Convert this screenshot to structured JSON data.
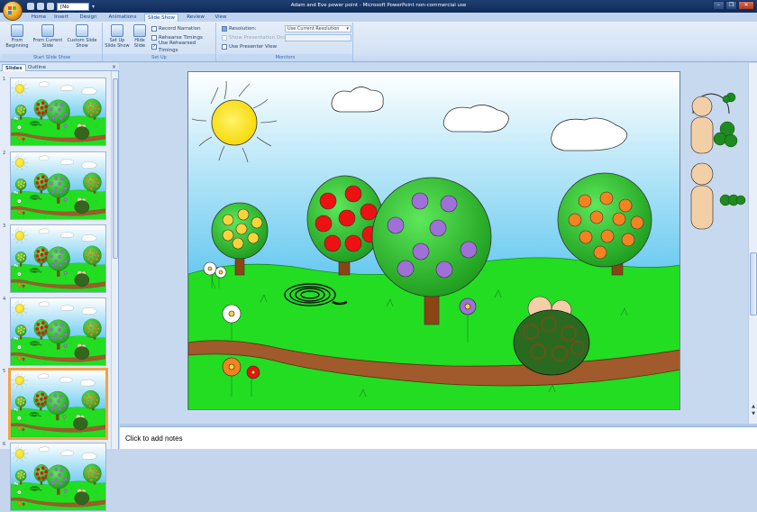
{
  "window": {
    "title": "Adam and Eve power point - Microsoft PowerPoint non-commercial use"
  },
  "qat": {
    "sound_value": "[No Sound]"
  },
  "tabs": [
    {
      "label": "Home",
      "active": false
    },
    {
      "label": "Insert",
      "active": false
    },
    {
      "label": "Design",
      "active": false
    },
    {
      "label": "Animations",
      "active": false
    },
    {
      "label": "Slide Show",
      "active": true
    },
    {
      "label": "Review",
      "active": false
    },
    {
      "label": "View",
      "active": false
    }
  ],
  "ribbon": {
    "start_group": {
      "label": "Start Slide Show",
      "from_beginning": "From Beginning",
      "from_current": "From Current Slide",
      "custom": "Custom Slide Show"
    },
    "setup_group": {
      "label": "Set Up",
      "setup_slideshow": "Set Up Slide Show",
      "hide_slide": "Hide Slide",
      "record_narration": "Record Narration",
      "rehearse_timings": "Rehearse Timings",
      "use_rehearsed": "Use Rehearsed Timings"
    },
    "monitors_group": {
      "label": "Monitors",
      "resolution_label": "Resolution:",
      "resolution_value": "Use Current Resolution",
      "show_on_label": "Show Presentation On:",
      "presenter_view": "Use Presenter View"
    }
  },
  "left_pane": {
    "tab_slides": "Slides",
    "tab_outline": "Outline",
    "slide_numbers": [
      "1",
      "2",
      "3",
      "4",
      "5",
      "6"
    ],
    "selected_slide": 5
  },
  "notes": {
    "placeholder": "Click to add notes"
  },
  "colors": {
    "sky_top": "#ffffff",
    "sky_bottom": "#4fc1ee",
    "grass": "#22dd22",
    "path": "#a05a2c",
    "selection": "#f3a247"
  }
}
